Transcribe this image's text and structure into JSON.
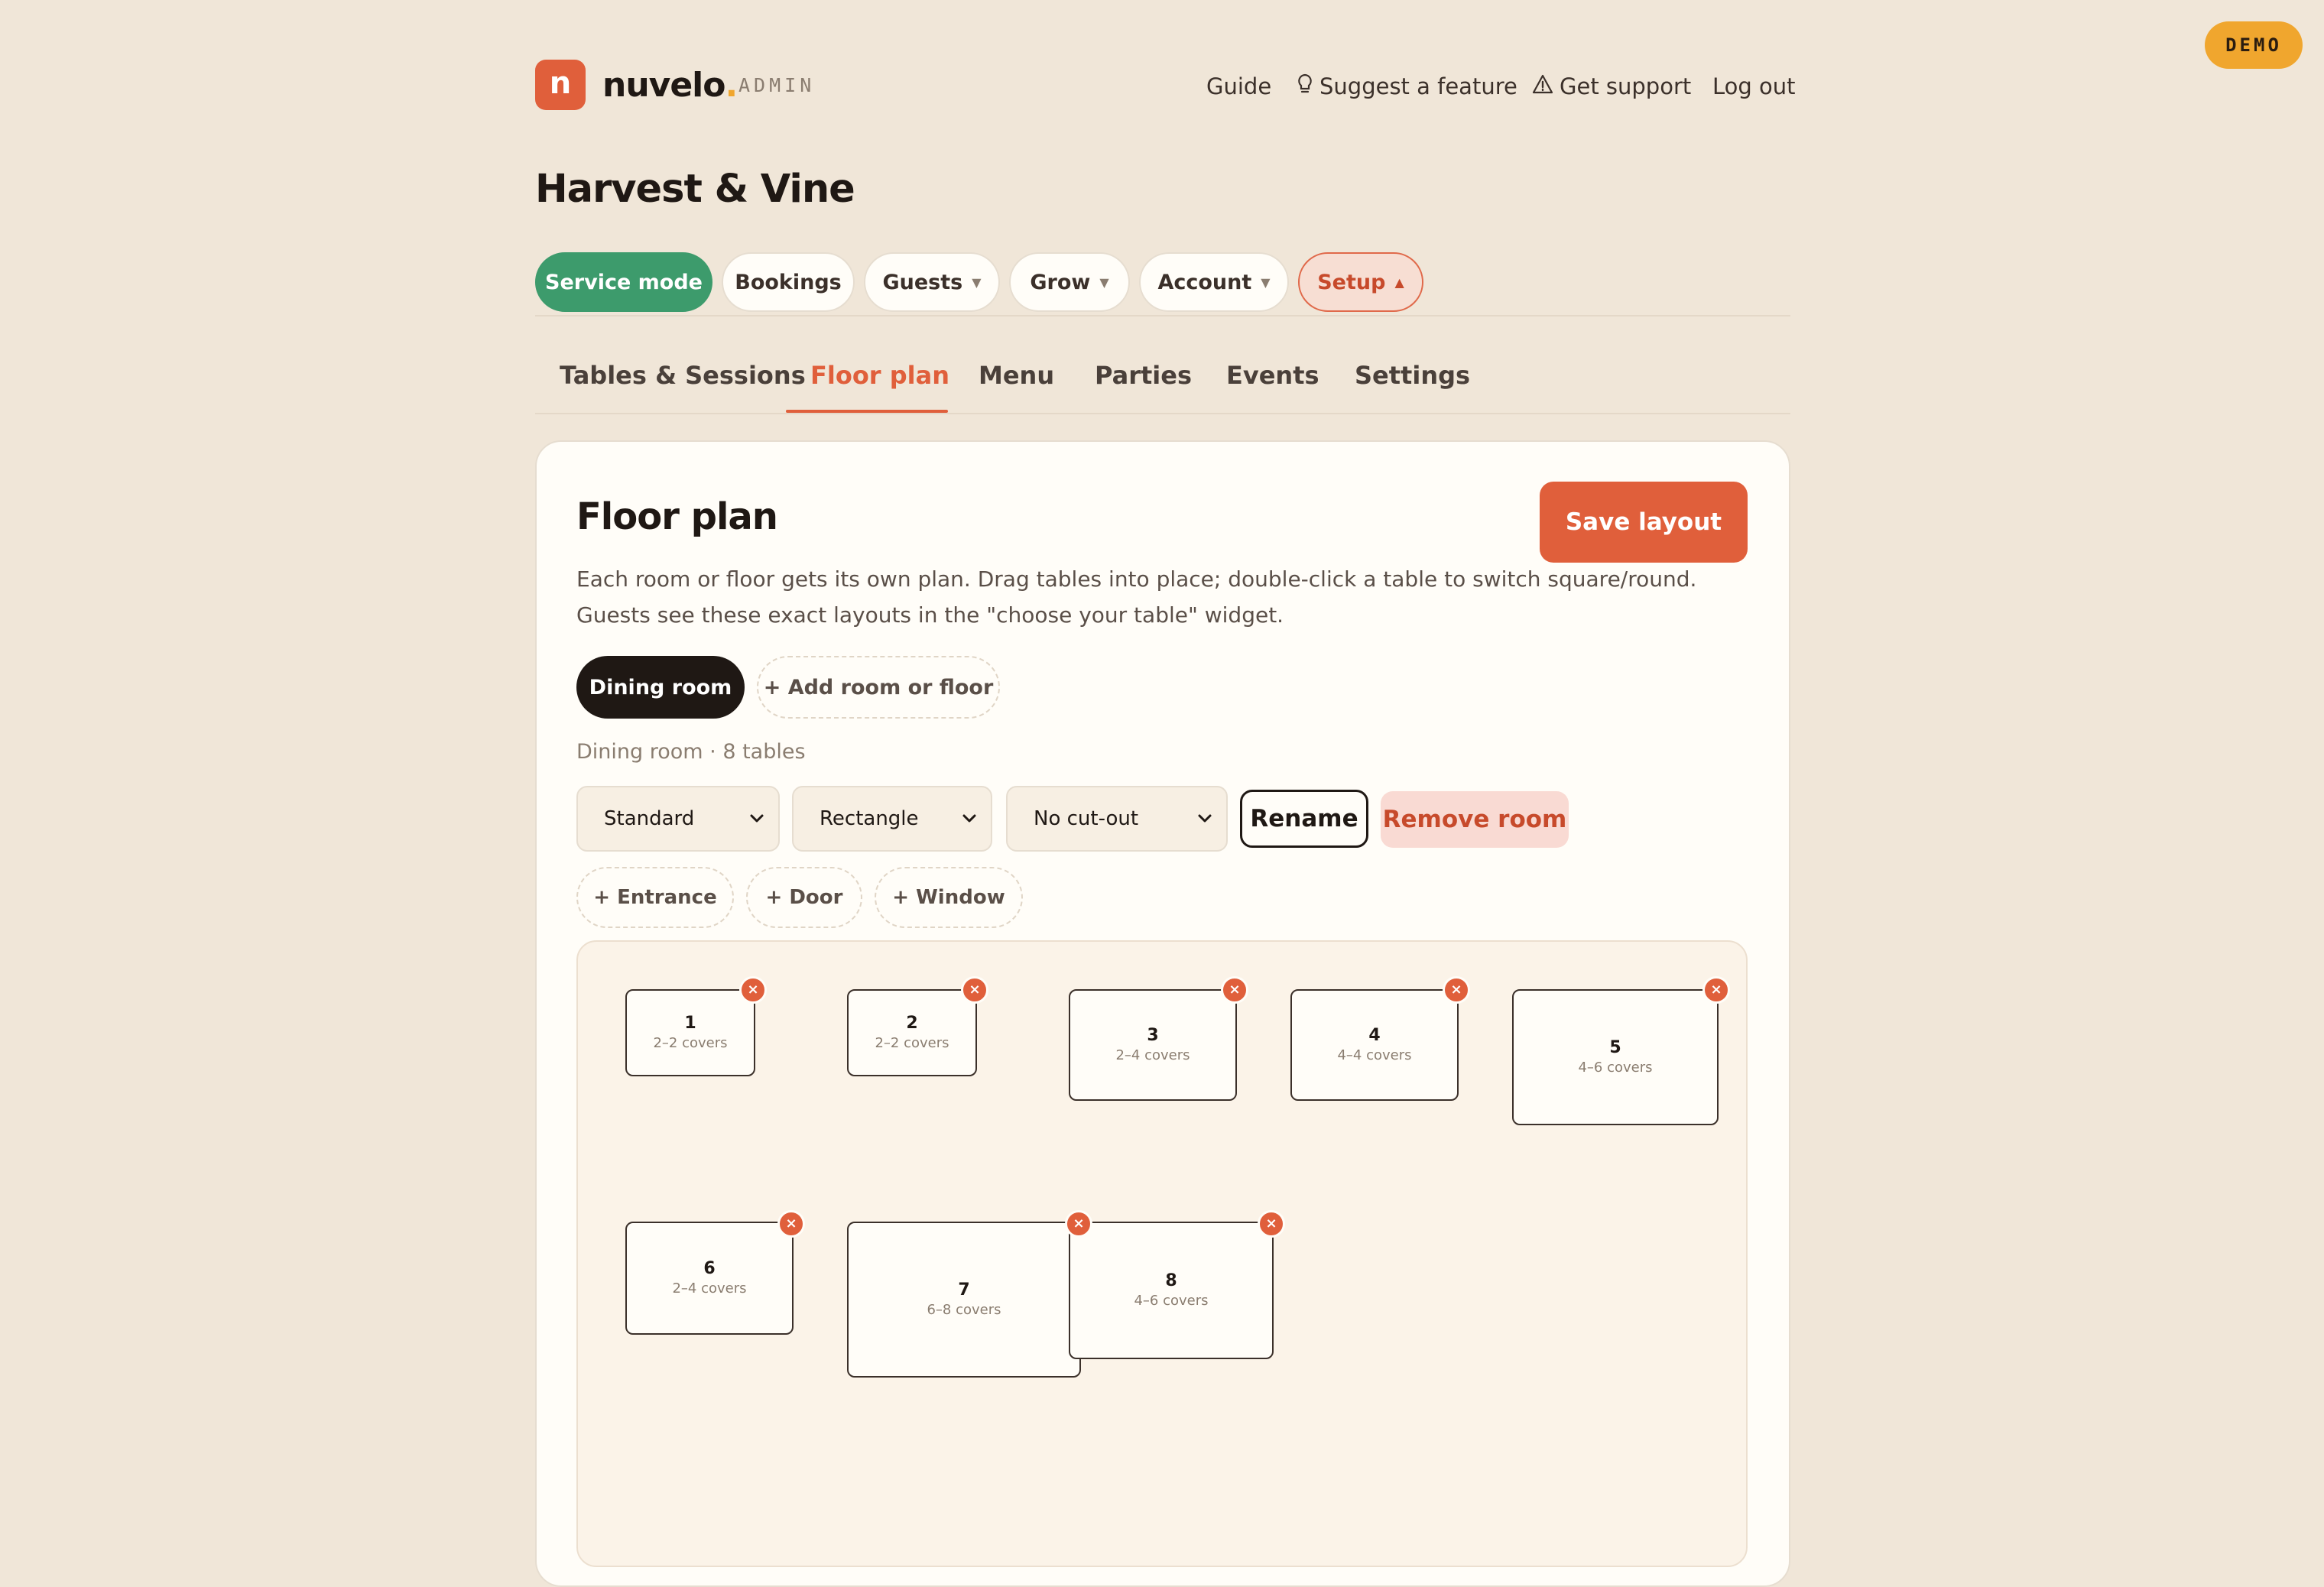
{
  "demo_badge": "DEMO",
  "brand": {
    "logo_letter": "n",
    "name": "nuvelo",
    "dot": ".",
    "tag": "ADMIN"
  },
  "topnav": {
    "guide": "Guide",
    "suggest": "Suggest a feature",
    "support": "Get support",
    "logout": "Log out"
  },
  "venue_name": "Harvest & Vine",
  "main_nav": [
    {
      "label": "Service mode",
      "state": "active"
    },
    {
      "label": "Bookings"
    },
    {
      "label": "Guests",
      "icon": "caret-down"
    },
    {
      "label": "Grow",
      "icon": "caret-down"
    },
    {
      "label": "Account",
      "icon": "caret-down"
    },
    {
      "label": "Setup",
      "icon": "caret-up",
      "state": "open"
    }
  ],
  "sub_tabs": [
    {
      "label": "Tables & Sessions"
    },
    {
      "label": "Floor plan",
      "state": "active"
    },
    {
      "label": "Menu"
    },
    {
      "label": "Parties"
    },
    {
      "label": "Events"
    },
    {
      "label": "Settings"
    }
  ],
  "floorplan": {
    "title": "Floor plan",
    "save_label": "Save layout",
    "description": "Each room or floor gets its own plan. Drag tables into place; double-click a table to switch square/round. Guests see these exact layouts in the \"choose your table\" widget.",
    "rooms": [
      {
        "label": "Dining room",
        "state": "active"
      }
    ],
    "add_room_label": "+ Add room or floor",
    "room_meta": "Dining room · 8 tables",
    "selects": {
      "style": "Standard",
      "shape": "Rectangle",
      "cutout": "No cut-out"
    },
    "rename_label": "Rename",
    "remove_label": "Remove room",
    "features": [
      "+ Entrance",
      "+ Door",
      "+ Window"
    ],
    "tables": [
      {
        "number": "1",
        "covers": "2–2 covers"
      },
      {
        "number": "2",
        "covers": "2–2 covers"
      },
      {
        "number": "3",
        "covers": "2–4 covers"
      },
      {
        "number": "4",
        "covers": "4–4 covers"
      },
      {
        "number": "5",
        "covers": "4–6 covers"
      },
      {
        "number": "6",
        "covers": "2–4 covers"
      },
      {
        "number": "7",
        "covers": "6–8 covers"
      },
      {
        "number": "8",
        "covers": "4–6 covers"
      }
    ]
  },
  "colors": {
    "background": "#f0e6d8",
    "brand": "#e05f3b",
    "service_mode": "#3d9b6c",
    "demo": "#f0a62e",
    "ink": "#1f1814"
  }
}
